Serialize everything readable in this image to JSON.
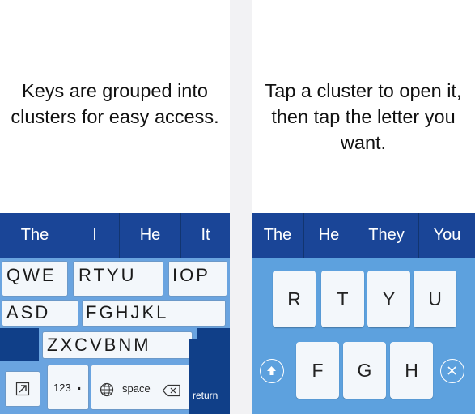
{
  "left": {
    "caption": "Keys are grouped into clusters for easy access.",
    "suggestions": [
      "The",
      "I",
      "He",
      "It"
    ],
    "rows": {
      "row1": [
        "QWE",
        "RTYU",
        "IOP"
      ],
      "row2": [
        "ASD",
        "FGHJKL"
      ],
      "row3": "ZXCVBNM"
    },
    "bottom": {
      "numbers_label": "123",
      "period_label": ".",
      "space_label": "space",
      "return_label": "return"
    }
  },
  "right": {
    "caption": "Tap a cluster to open it, then tap the letter you want.",
    "suggestions": [
      "The",
      "He",
      "They",
      "You"
    ],
    "row1": [
      "R",
      "T",
      "Y",
      "U"
    ],
    "row2": [
      "F",
      "G",
      "H"
    ]
  },
  "colors": {
    "suggestion_bar": "#1a4597",
    "keyboard_dark": "#103f88",
    "keyboard_light": "#5da1de",
    "key_face": "#f3f7fb"
  }
}
